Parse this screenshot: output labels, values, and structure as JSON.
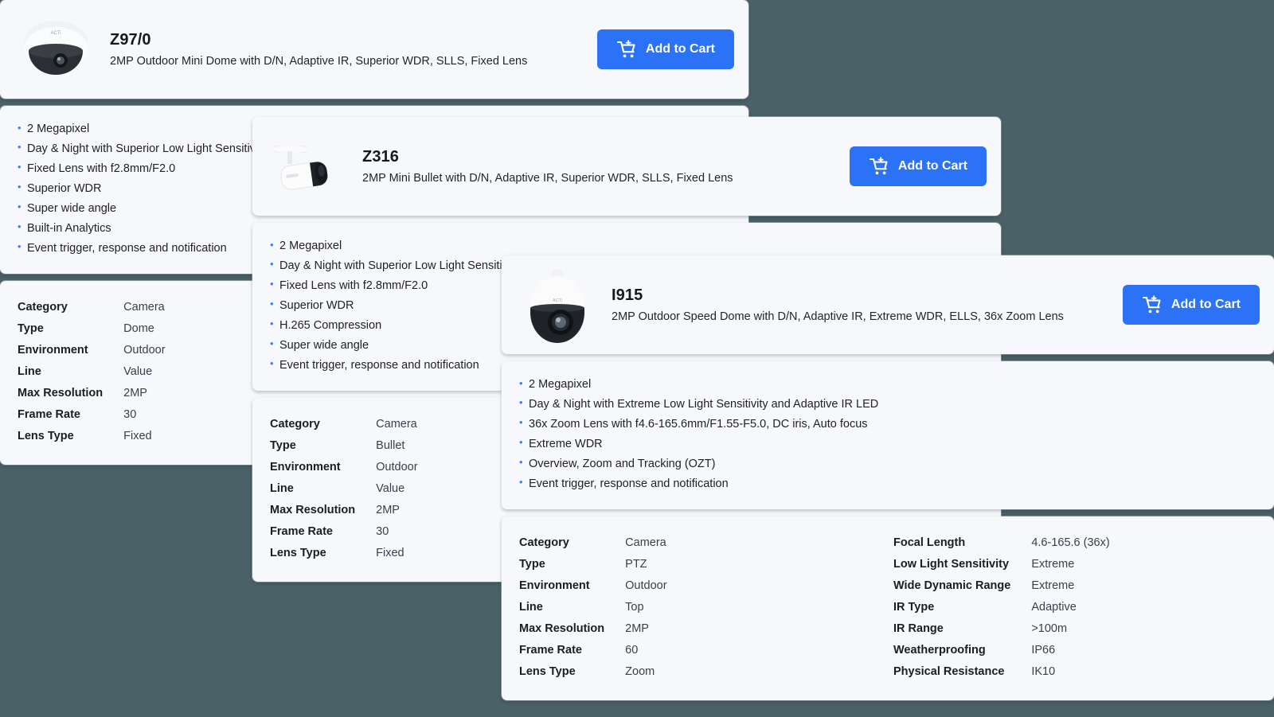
{
  "page": {
    "background_color": "#4a6168",
    "card_background": "#f6f8fc",
    "accent_color": "#2b72f6",
    "bullet_color": "#3d7df6"
  },
  "cart_button_label": "Add to Cart",
  "products": [
    {
      "id": "z970",
      "name": "Z97/0",
      "description": "2MP Outdoor Mini Dome with D/N, Adaptive IR, Superior WDR, SLLS, Fixed Lens",
      "thumbnail_icon": "dome-camera-icon",
      "cart_label": "Add to Cart",
      "features": [
        "2 Megapixel",
        "Day & Night with Superior Low Light Sensitivity",
        "Fixed Lens with f2.8mm/F2.0",
        "Superior WDR",
        "Super wide angle",
        "Built-in Analytics",
        "Event trigger, response and notification"
      ],
      "specs_left": [
        {
          "key": "Category",
          "value": "Camera"
        },
        {
          "key": "Type",
          "value": "Dome"
        },
        {
          "key": "Environment",
          "value": "Outdoor"
        },
        {
          "key": "Line",
          "value": "Value"
        },
        {
          "key": "Max Resolution",
          "value": "2MP"
        },
        {
          "key": "Frame Rate",
          "value": "30"
        },
        {
          "key": "Lens Type",
          "value": "Fixed"
        }
      ],
      "specs_right": []
    },
    {
      "id": "z316",
      "name": "Z316",
      "description": "2MP Mini Bullet with D/N, Adaptive IR, Superior WDR, SLLS, Fixed Lens",
      "thumbnail_icon": "bullet-camera-icon",
      "cart_label": "Add to Cart",
      "features": [
        "2 Megapixel",
        "Day & Night with Superior Low Light Sensitivity",
        "Fixed Lens with f2.8mm/F2.0",
        "Superior WDR",
        "H.265 Compression",
        "Super wide angle",
        "Event trigger, response and notification"
      ],
      "specs_left": [
        {
          "key": "Category",
          "value": "Camera"
        },
        {
          "key": "Type",
          "value": "Bullet"
        },
        {
          "key": "Environment",
          "value": "Outdoor"
        },
        {
          "key": "Line",
          "value": "Value"
        },
        {
          "key": "Max Resolution",
          "value": "2MP"
        },
        {
          "key": "Frame Rate",
          "value": "30"
        },
        {
          "key": "Lens Type",
          "value": "Fixed"
        }
      ],
      "specs_right": []
    },
    {
      "id": "i915",
      "name": "I915",
      "description": "2MP Outdoor Speed Dome with D/N, Adaptive IR, Extreme WDR, ELLS, 36x Zoom Lens",
      "thumbnail_icon": "ptz-speed-dome-icon",
      "cart_label": "Add to Cart",
      "features": [
        "2 Megapixel",
        "Day & Night with Extreme Low Light Sensitivity and Adaptive IR LED",
        "36x Zoom Lens with f4.6-165.6mm/F1.55-F5.0, DC iris, Auto focus",
        "Extreme WDR",
        "Overview, Zoom and Tracking (OZT)",
        "Event trigger, response and notification"
      ],
      "specs_left": [
        {
          "key": "Category",
          "value": "Camera"
        },
        {
          "key": "Type",
          "value": "PTZ"
        },
        {
          "key": "Environment",
          "value": "Outdoor"
        },
        {
          "key": "Line",
          "value": "Top"
        },
        {
          "key": "Max Resolution",
          "value": "2MP"
        },
        {
          "key": "Frame Rate",
          "value": "60"
        },
        {
          "key": "Lens Type",
          "value": "Zoom"
        }
      ],
      "specs_right": [
        {
          "key": "Focal Length",
          "value": "4.6-165.6 (36x)"
        },
        {
          "key": "Low Light Sensitivity",
          "value": "Extreme"
        },
        {
          "key": "Wide Dynamic Range",
          "value": "Extreme"
        },
        {
          "key": "IR Type",
          "value": "Adaptive"
        },
        {
          "key": "IR Range",
          "value": ">100m"
        },
        {
          "key": "Weatherproofing",
          "value": "IP66"
        },
        {
          "key": "Physical Resistance",
          "value": "IK10"
        }
      ]
    }
  ]
}
